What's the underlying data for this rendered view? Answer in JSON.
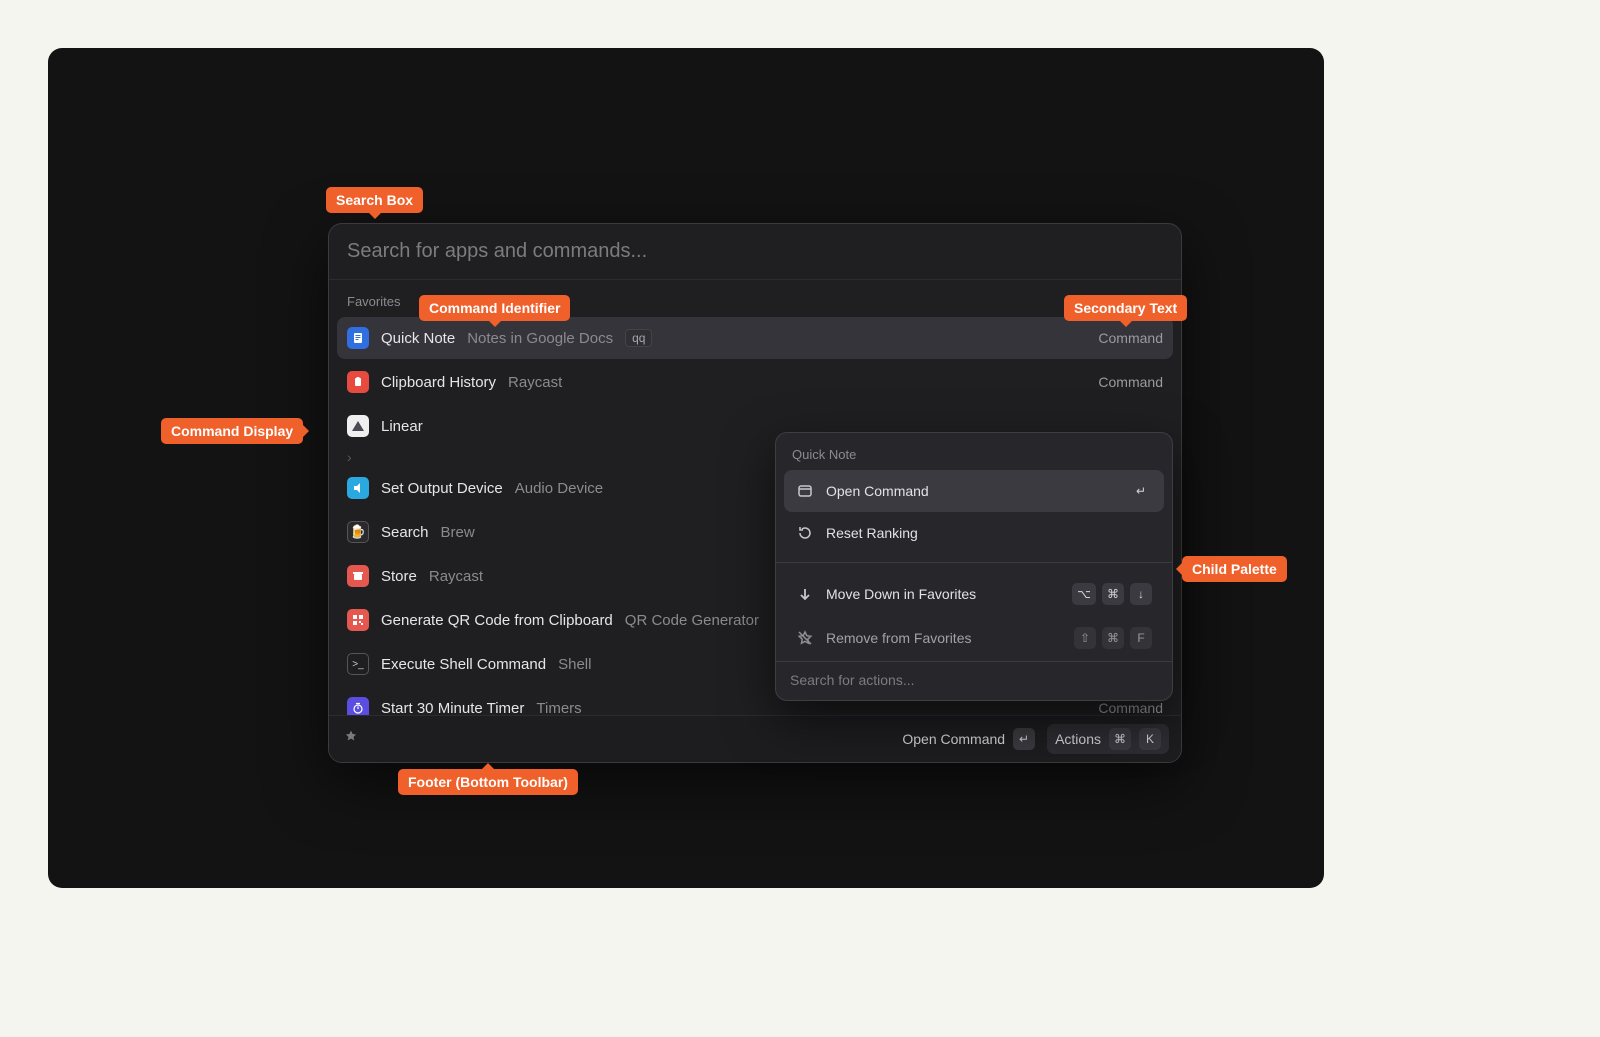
{
  "annotations": {
    "search_box": "Search Box",
    "command_identifier": "Command Identifier",
    "secondary_text": "Secondary Text",
    "command_display": "Command Display",
    "child_palette": "Child Palette",
    "footer": "Footer (Bottom Toolbar)"
  },
  "palette": {
    "search_placeholder": "Search for apps and commands...",
    "section_label": "Favorites",
    "items": [
      {
        "title": "Quick Note",
        "subtitle": "Notes in Google Docs",
        "alias": "qq",
        "type": "Command",
        "selected": true,
        "icon": "doc"
      },
      {
        "title": "Clipboard History",
        "subtitle": "Raycast",
        "type": "Command",
        "icon": "clipboard"
      },
      {
        "title": "Linear",
        "submenu": true,
        "icon": "linear"
      },
      {
        "title": "Set Output Device",
        "subtitle": "Audio Device",
        "icon": "audio"
      },
      {
        "title": "Search",
        "subtitle": "Brew",
        "icon": "brew"
      },
      {
        "title": "Store",
        "subtitle": "Raycast",
        "icon": "store"
      },
      {
        "title": "Generate QR Code from Clipboard",
        "subtitle": "QR Code Generator",
        "icon": "qr"
      },
      {
        "title": "Execute Shell Command",
        "subtitle": "Shell",
        "icon": "shell"
      },
      {
        "title": "Start 30 Minute Timer",
        "subtitle": "Timers",
        "type": "Command",
        "icon": "timer"
      }
    ],
    "footer": {
      "primary_label": "Open Command",
      "primary_key": "↵",
      "actions_label": "Actions",
      "actions_keys": [
        "⌘",
        "K"
      ]
    }
  },
  "subpanel": {
    "title": "Quick Note",
    "items": [
      {
        "label": "Open Command",
        "icon": "open",
        "keys": [
          "↵"
        ],
        "selected": true
      },
      {
        "label": "Reset Ranking",
        "icon": "reset"
      }
    ],
    "secondary": [
      {
        "label": "Move Down in Favorites",
        "icon": "down",
        "keys": [
          "⌥",
          "⌘",
          "↓"
        ]
      },
      {
        "label": "Remove from Favorites",
        "icon": "unfav",
        "keys": [
          "⇧",
          "⌘",
          "F"
        ],
        "faded": true
      }
    ],
    "search_placeholder": "Search for actions..."
  }
}
